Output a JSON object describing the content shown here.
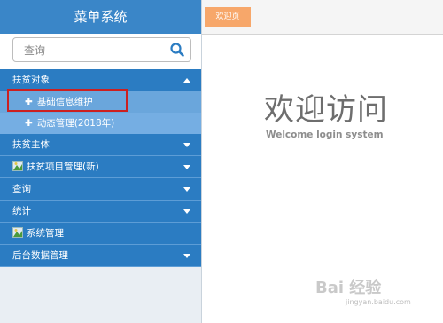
{
  "sidebar": {
    "title": "菜单系统",
    "search": {
      "placeholder": "查询"
    },
    "menus": [
      {
        "label": "扶贫对象",
        "expanded": true,
        "items": [
          {
            "label": "基础信息维护",
            "selected": true
          },
          {
            "label": "动态管理(2018年)"
          }
        ]
      },
      {
        "label": "扶贫主体"
      },
      {
        "label": "扶贫项目管理(新)",
        "icon": "image-icon"
      },
      {
        "label": "查询"
      },
      {
        "label": "统计"
      },
      {
        "label": "系统管理",
        "icon": "image-icon"
      },
      {
        "label": "后台数据管理"
      }
    ]
  },
  "main": {
    "tab": "欢迎页",
    "welcome_title": "欢迎访问",
    "welcome_subtitle": "Welcome login system"
  },
  "watermark": {
    "text": "Bai 经验",
    "sub": "jingyan.baidu.com"
  },
  "colors": {
    "header": "#3a86c8",
    "menu": "#2b7cc2",
    "submenu": "#75aee3",
    "tab": "#f7a76a",
    "highlight": "#cc2020"
  }
}
